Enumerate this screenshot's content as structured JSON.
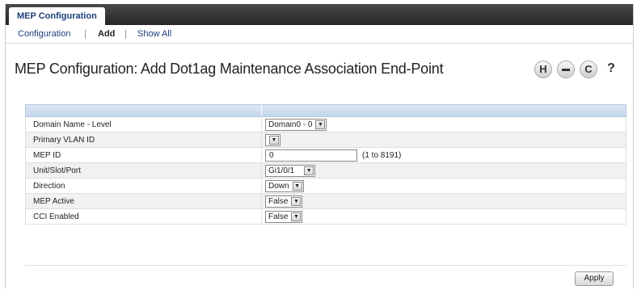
{
  "header": {
    "active_tab": "MEP Configuration"
  },
  "subnav": {
    "items": [
      "Configuration",
      "Add",
      "Show All"
    ],
    "active": "Add"
  },
  "page": {
    "title": "MEP Configuration: Add Dot1ag Maintenance Association End-Point"
  },
  "toolbar": {
    "icons": [
      "save-icon",
      "print-icon",
      "refresh-icon",
      "help-icon"
    ],
    "glyphs": [
      "H",
      "▬",
      "C",
      "?"
    ]
  },
  "form": {
    "rows": [
      {
        "label": "Domain Name - Level",
        "type": "select",
        "value": "Domain0 - 0"
      },
      {
        "label": "Primary VLAN ID",
        "type": "select",
        "value": ""
      },
      {
        "label": "MEP ID",
        "type": "text",
        "value": "0",
        "hint": "(1 to 8191)"
      },
      {
        "label": "Unit/Slot/Port",
        "type": "select",
        "value": "Gi1/0/1"
      },
      {
        "label": "Direction",
        "type": "select",
        "value": "Down"
      },
      {
        "label": "MEP Active",
        "type": "select",
        "value": "False"
      },
      {
        "label": "CCI Enabled",
        "type": "select",
        "value": "False"
      }
    ]
  },
  "footer": {
    "apply_label": "Apply"
  }
}
